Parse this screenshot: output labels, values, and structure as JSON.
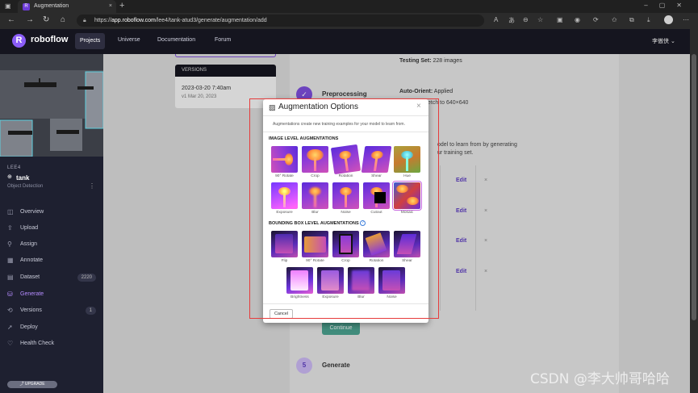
{
  "browser": {
    "tab_title": "Augmentation",
    "tab_close": "×",
    "new_tab": "+",
    "url_scheme": "https://",
    "url_host": "app.roboflow.com",
    "url_path": "/lee4/tank-atud3/generate/augmentation/add"
  },
  "app": {
    "brand": "roboflow",
    "nav": [
      "Projects",
      "Universe",
      "Documentation",
      "Forum"
    ],
    "user": "李傲侠 ⌄"
  },
  "project": {
    "workspace": "LEE4",
    "name": "tank",
    "type": "Object Detection"
  },
  "sidebar": {
    "items": [
      {
        "label": "Overview",
        "icon": "◫"
      },
      {
        "label": "Upload",
        "icon": "⇪"
      },
      {
        "label": "Assign",
        "icon": "⚲"
      },
      {
        "label": "Annotate",
        "icon": "▦"
      },
      {
        "label": "Dataset",
        "icon": "▤",
        "count": "2220"
      },
      {
        "label": "Generate",
        "icon": "⛁"
      },
      {
        "label": "Versions",
        "icon": "⟲",
        "count": "1"
      },
      {
        "label": "Deploy",
        "icon": "➚"
      },
      {
        "label": "Health Check",
        "icon": "♡"
      }
    ],
    "upgrade": "⤴ UPGRADE"
  },
  "versions": {
    "header": "VERSIONS",
    "date": "2023-03-20 7:40am",
    "sub": "v1 Mar 20, 2023"
  },
  "steps": {
    "testing_set_label": "Testing Set:",
    "testing_set_value": "228 images",
    "preprocessing": "Preprocessing",
    "auto_orient_label": "Auto-Orient:",
    "auto_orient_value": "Applied",
    "resize": "etch to 640×640",
    "aug_desc_1": "odel to learn from by generating",
    "aug_desc_2": "ur training set.",
    "edit": "Edit",
    "continue": "Continue",
    "step5_num": "5",
    "generate": "Generate"
  },
  "modal": {
    "title": "Augmentation Options",
    "description": "Augmentations create new training examples for your model to learn from.",
    "image_level_title": "IMAGE LEVEL AUGMENTATIONS",
    "image_level": [
      "90° Rotate",
      "Crop",
      "Rotation",
      "Shear",
      "Hue",
      "Exposure",
      "Blur",
      "Noise",
      "Cutout",
      "Mosaic"
    ],
    "bbox_level_title": "BOUNDING BOX LEVEL AUGMENTATIONS",
    "bbox_level": [
      "Flip",
      "90° Rotate",
      "Crop",
      "Rotation",
      "Shear",
      "Brightness",
      "Exposure",
      "Blur",
      "Noise"
    ],
    "cancel": "Cancel",
    "close": "×"
  },
  "watermark": "CSDN @李大帅哥哈哈",
  "colors": {
    "accent": "#7c4dd9",
    "continue": "#4aa08e",
    "annotation": "#e63c3c"
  }
}
